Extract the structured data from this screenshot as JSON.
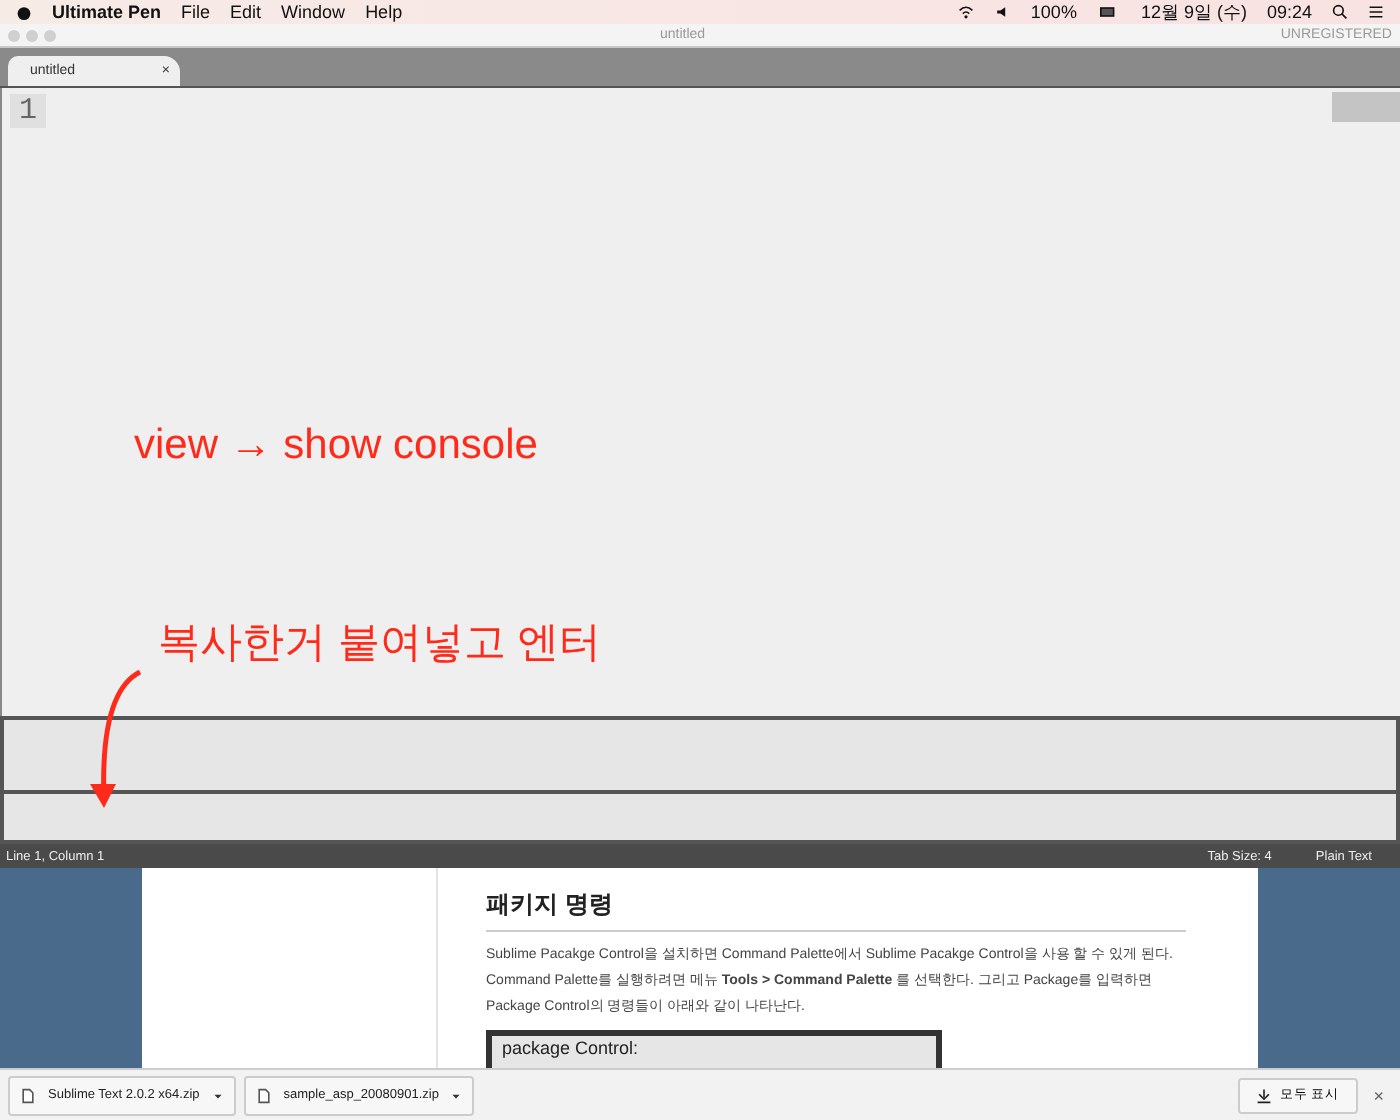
{
  "menubar": {
    "app": "Ultimate Pen",
    "menus": [
      "File",
      "Edit",
      "Window",
      "Help"
    ],
    "battery": "100%",
    "date": "12월 9일 (수)",
    "time": "09:24"
  },
  "window": {
    "title": "untitled",
    "license": "UNREGISTERED"
  },
  "tabs": [
    {
      "label": "untitled",
      "close": "×",
      "selected": true
    }
  ],
  "editor": {
    "line_numbers": [
      "1"
    ]
  },
  "annotations": [
    {
      "text": "view → show console"
    },
    {
      "text": "복사한거 붙여넣고 엔터"
    }
  ],
  "status_bar": {
    "position": "Line 1, Column 1",
    "tab_size": "Tab Size: 4",
    "syntax": "Plain Text"
  },
  "webpage": {
    "heading": "패키지 명령",
    "paragraph": "Sublime Pacakge Control을 설치하면 Command Palette에서 Sublime Pacakge Control을 사용 할 수 있게 된다. Command Palette를 실행하려면 메뉴 **Tools > Command Palette** 를 선택한다. 그리고 Package를 입력하면 Package Control의 명령들이 아래와 같이 나타난다.",
    "screenshot_text": "package Control:"
  },
  "downloads": {
    "files": [
      "Sublime Text 2.0.2 x64.zip",
      "sample_asp_20080901.zip"
    ],
    "show_all": "모두 표시",
    "close": "×"
  }
}
